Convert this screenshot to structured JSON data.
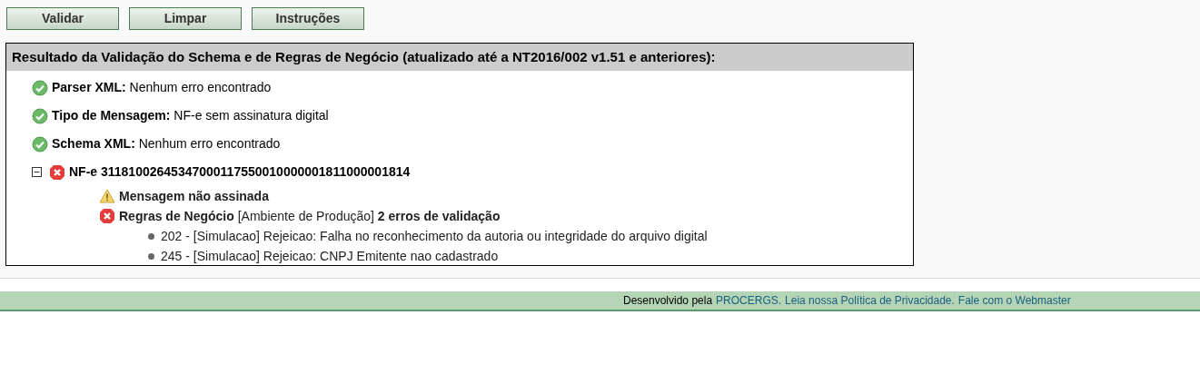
{
  "buttons": [
    "Validar",
    "Limpar",
    "Instruções"
  ],
  "result": {
    "title": "Resultado da Validação do Schema e de Regras de Negócio (atualizado até a NT2016/002 v1.51 e anteriores):",
    "checks": [
      {
        "kind": "ok",
        "label": "Parser XML:",
        "text": "Nenhum erro encontrado"
      },
      {
        "kind": "ok",
        "label": "Tipo de Mensagem:",
        "text": "NF-e sem assinatura digital"
      },
      {
        "kind": "ok",
        "label": "Schema XML:",
        "text": "Nenhum erro encontrado"
      }
    ],
    "nfe": {
      "expanded": true,
      "kind": "error",
      "label": "NF-e 31181002645347000117550010000001811000001814",
      "children": [
        {
          "kind": "warning",
          "text": "**Mensagem não assinada**"
        },
        {
          "kind": "error",
          "text": "**Regras de Negócio** [Ambiente de Produção] **2 erros de validação**",
          "errors": [
            "202 - [Simulacao] Rejeicao: Falha no reconhecimento da autoria ou integridade do arquivo digital",
            "245 - [Simulacao] Rejeicao: CNPJ Emitente nao cadastrado"
          ]
        }
      ]
    }
  },
  "footer": {
    "text": "Desenvolvido pela",
    "links": [
      "PROCERGS.",
      "Leia nossa Política de Privacidade.",
      "Fale com o Webmaster"
    ]
  }
}
